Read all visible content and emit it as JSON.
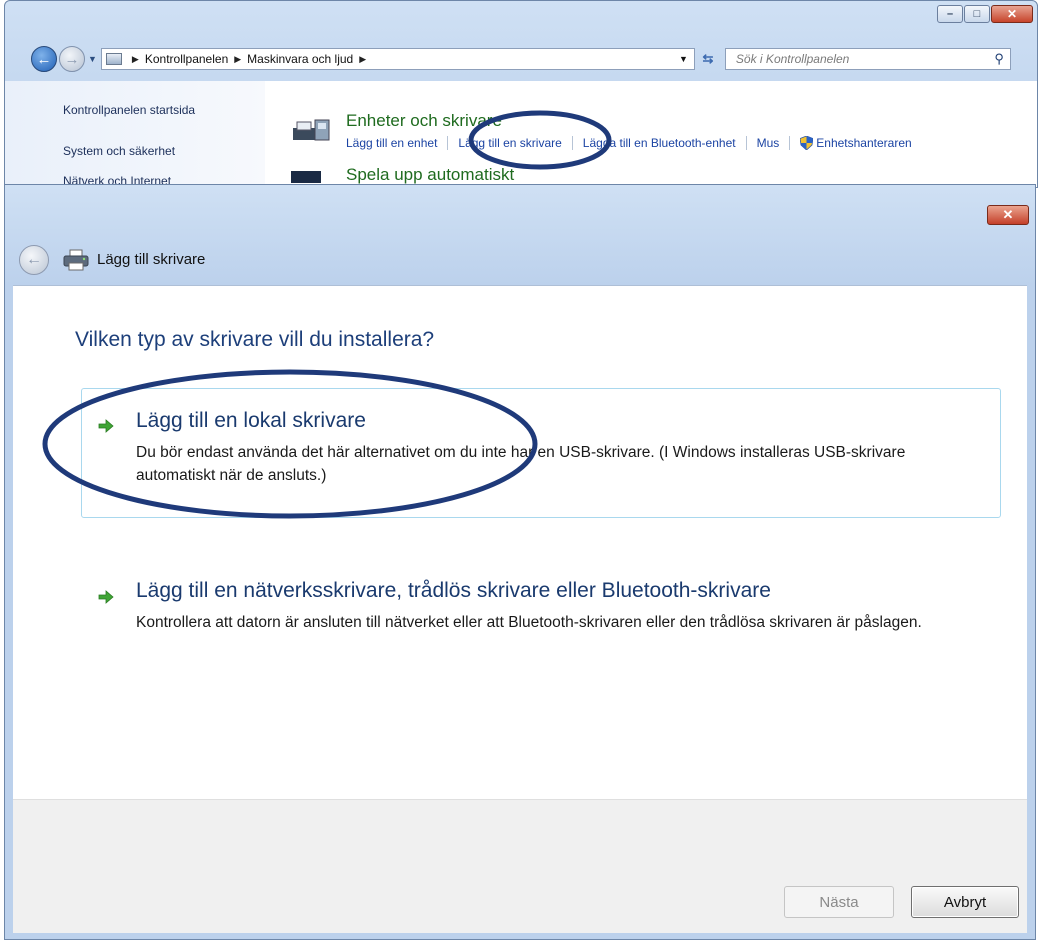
{
  "control_panel": {
    "breadcrumb": [
      "Kontrollpanelen",
      "Maskinvara och ljud"
    ],
    "search_placeholder": "Sök i Kontrollpanelen",
    "left_nav": [
      "Kontrollpanelen startsida",
      "System och säkerhet",
      "Nätverk och Internet"
    ],
    "category_title": "Enheter och skrivare",
    "links": {
      "add_device": "Lägg till en enhet",
      "add_printer": "Lägg till en skrivare",
      "add_bluetooth": "Lägga till en Bluetooth-enhet",
      "mouse": "Mus",
      "device_manager": "Enhetshanteraren"
    },
    "next_category_title": "Spela upp automatiskt"
  },
  "dialog": {
    "title": "Lägg till skrivare",
    "heading": "Vilken typ av skrivare vill du installera?",
    "options": [
      {
        "title": "Lägg till en lokal skrivare",
        "description": "Du bör endast använda det här alternativet om du inte har en USB-skrivare. (I Windows installeras USB-skrivare automatiskt när de ansluts.)"
      },
      {
        "title": "Lägg till en nätverksskrivare, trådlös skrivare eller Bluetooth-skrivare",
        "description": "Kontrollera att datorn är ansluten till nätverket eller att Bluetooth-skrivaren eller den trådlösa skrivaren är påslagen."
      }
    ],
    "buttons": {
      "next": "Nästa",
      "cancel": "Avbryt"
    }
  },
  "colors": {
    "arrow_green": "#3fa535",
    "annotation_blue": "#1f3a7a",
    "link_blue": "#1c44a3"
  },
  "icons": [
    "back-arrow-icon",
    "forward-arrow-icon",
    "control-panel-icon",
    "refresh-icon",
    "search-icon",
    "printer-icon",
    "shield-icon",
    "green-arrow-icon",
    "close-icon"
  ]
}
